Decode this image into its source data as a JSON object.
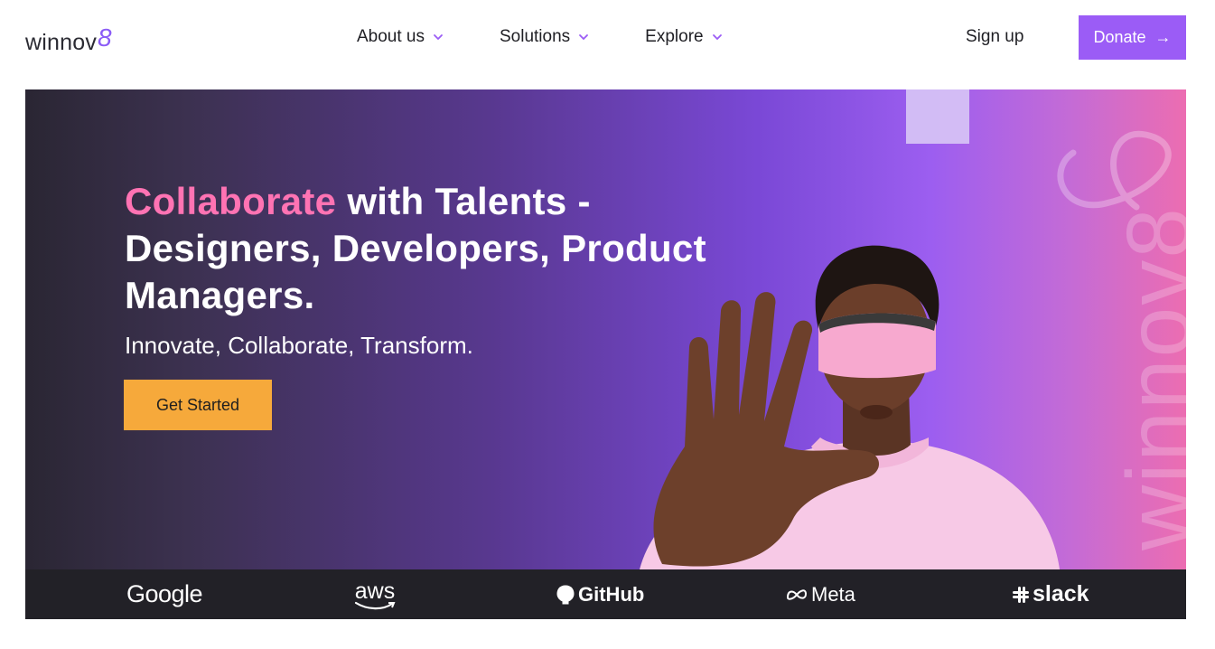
{
  "brand": {
    "name": "winnov",
    "mark": "8"
  },
  "nav": {
    "items": [
      {
        "label": "About us"
      },
      {
        "label": "Solutions"
      },
      {
        "label": "Explore"
      }
    ],
    "signup_label": "Sign up",
    "donate_label": "Donate",
    "donate_icon": "arrow-right-icon"
  },
  "hero": {
    "headline_accent": "Collaborate",
    "headline_rest_1": " with Talents -",
    "headline_rest_2": "Designers, Developers, Product Managers.",
    "subline": "Innovate, Collaborate, Transform.",
    "cta_label": "Get Started",
    "watermark": "winnov8"
  },
  "partners": {
    "google": "Google",
    "aws": "aws",
    "github": "GitHub",
    "meta": "Meta",
    "slack": "slack"
  },
  "colors": {
    "accent": "#9b5cf6",
    "headline_accent": "#ff73b3",
    "cta": "#f6a93b",
    "partner_bar": "#222127"
  }
}
